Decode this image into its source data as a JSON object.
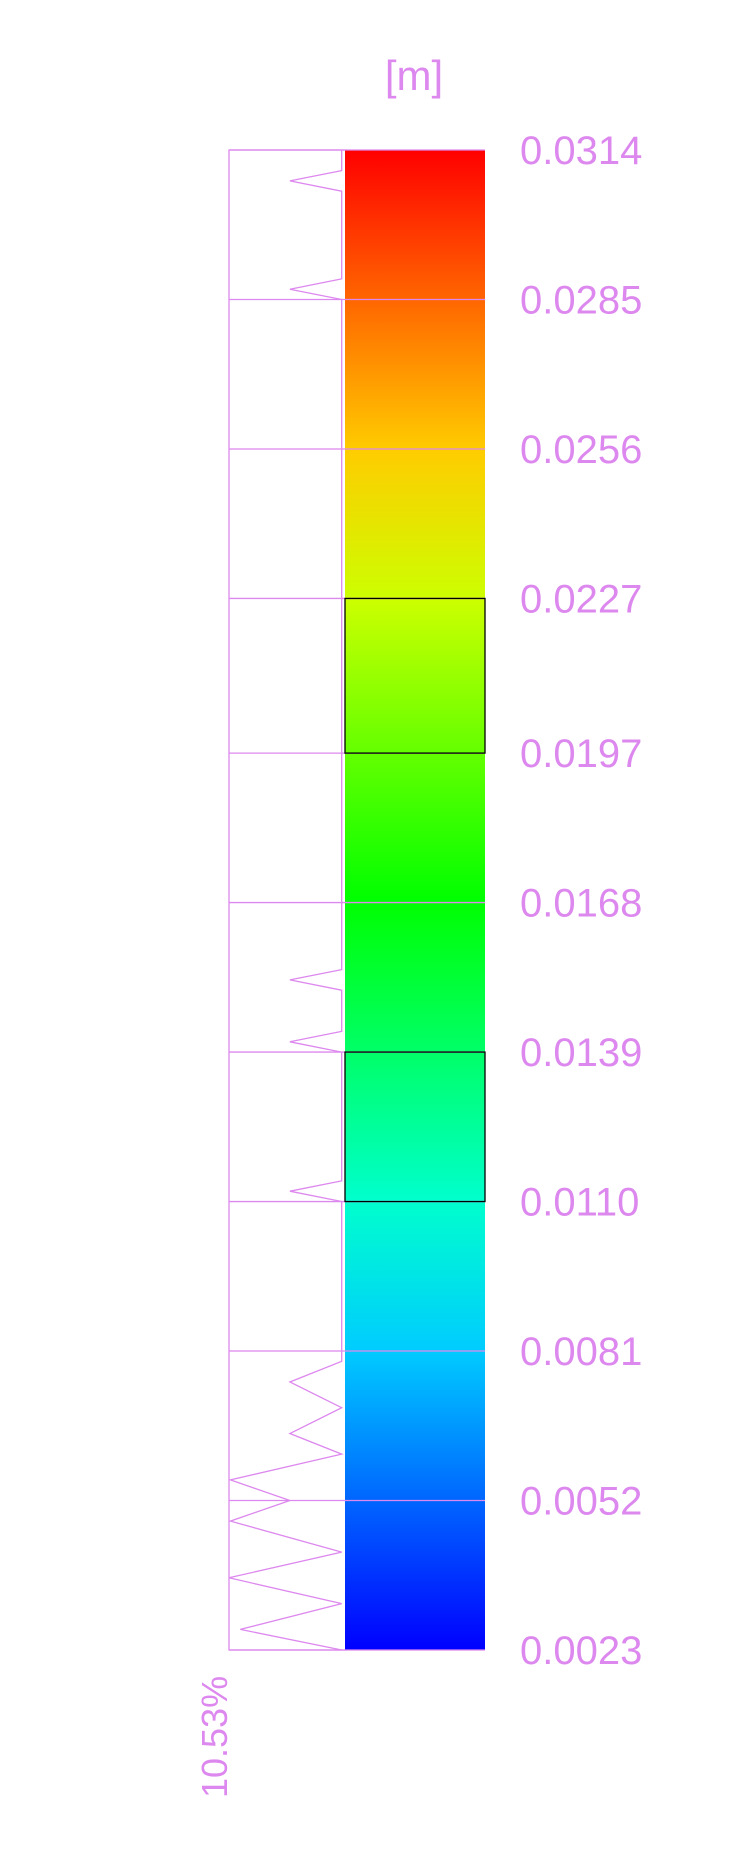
{
  "unit_label": "[m]",
  "max_percent_label": "10.53%",
  "colors": {
    "text": "#dd88ee",
    "outline": "#dd88ee",
    "highlight_border": "#000000"
  },
  "chart_data": {
    "type": "colorbar-histogram",
    "unit": "[m]",
    "boundaries": [
      "0.0023",
      "0.0052",
      "0.0081",
      "0.0110",
      "0.0139",
      "0.0168",
      "0.0197",
      "0.0227",
      "0.0256",
      "0.0285",
      "0.0314"
    ],
    "histogram_percent_max": 10.53,
    "histogram_profile": [
      [
        0.0023,
        0.3
      ],
      [
        0.0027,
        9.5
      ],
      [
        0.0032,
        0.3
      ],
      [
        0.0037,
        10.53
      ],
      [
        0.0042,
        0.3
      ],
      [
        0.0048,
        10.4
      ],
      [
        0.0052,
        5.0
      ],
      [
        0.0056,
        10.4
      ],
      [
        0.0061,
        0.3
      ],
      [
        0.0065,
        5.0
      ],
      [
        0.007,
        0.3
      ],
      [
        0.0075,
        5.0
      ],
      [
        0.0079,
        0.3
      ],
      [
        0.0081,
        0.3
      ],
      [
        0.011,
        0.3
      ],
      [
        0.0112,
        5.0
      ],
      [
        0.0114,
        0.3
      ],
      [
        0.0139,
        0.3
      ],
      [
        0.0141,
        5.0
      ],
      [
        0.0143,
        0.3
      ],
      [
        0.0151,
        0.3
      ],
      [
        0.0153,
        5.0
      ],
      [
        0.0155,
        0.3
      ],
      [
        0.0168,
        0.3
      ],
      [
        0.0285,
        0.3
      ],
      [
        0.0287,
        5.0
      ],
      [
        0.0289,
        0.3
      ],
      [
        0.0306,
        0.3
      ],
      [
        0.0308,
        5.0
      ],
      [
        0.031,
        0.3
      ],
      [
        0.0314,
        0.3
      ]
    ],
    "highlighted_ranges": [
      [
        "0.0110",
        "0.0139"
      ],
      [
        "0.0197",
        "0.0227"
      ]
    ],
    "colormap": [
      "#0000ff",
      "#0066ff",
      "#00ccff",
      "#00ffcc",
      "#00ff66",
      "#00ff00",
      "#66ff00",
      "#ccff00",
      "#ffcc00",
      "#ff6600",
      "#ff0000"
    ]
  }
}
